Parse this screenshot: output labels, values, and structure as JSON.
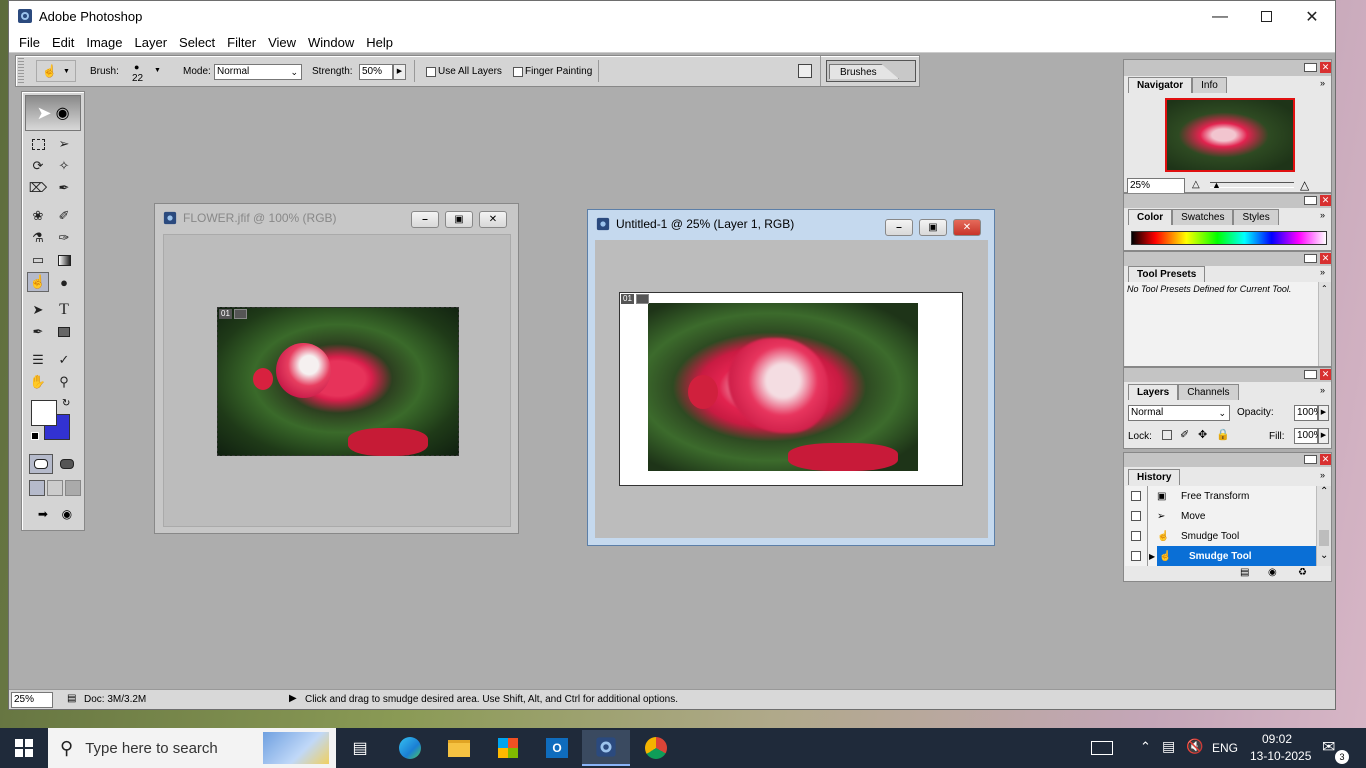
{
  "app": {
    "title": "Adobe Photoshop"
  },
  "menu": [
    "File",
    "Edit",
    "Image",
    "Layer",
    "Select",
    "Filter",
    "View",
    "Window",
    "Help"
  ],
  "options": {
    "brush_label": "Brush:",
    "brush_size": "22",
    "mode_label": "Mode:",
    "mode_value": "Normal",
    "strength_label": "Strength:",
    "strength_value": "50%",
    "use_all_layers": "Use All Layers",
    "finger_painting": "Finger Painting",
    "brushes_tab": "Brushes"
  },
  "doc1": {
    "title": "FLOWER.jfif @ 100% (RGB)",
    "layer_tag": "01"
  },
  "doc2": {
    "title": "Untitled-1 @ 25% (Layer 1, RGB)",
    "layer_tag": "01"
  },
  "navigator": {
    "tabs": [
      "Navigator",
      "Info"
    ],
    "zoom": "25%"
  },
  "color_panel": {
    "tabs": [
      "Color",
      "Swatches",
      "Styles"
    ]
  },
  "tool_presets": {
    "title": "Tool Presets",
    "message": "No Tool Presets Defined for Current Tool."
  },
  "layers": {
    "tabs": [
      "Layers",
      "Channels"
    ],
    "blend_mode": "Normal",
    "opacity_label": "Opacity:",
    "opacity_value": "100%",
    "lock_label": "Lock:",
    "fill_label": "Fill:",
    "fill_value": "100%"
  },
  "history": {
    "title": "History",
    "items": [
      "Free Transform",
      "Move",
      "Smudge Tool",
      "Smudge Tool"
    ],
    "selected_index": 3
  },
  "status": {
    "zoom": "25%",
    "doc": "Doc: 3M/3.2M",
    "hint": "Click and drag to smudge desired area.  Use Shift, Alt, and Ctrl for additional options."
  },
  "taskbar": {
    "search_placeholder": "Type here to search",
    "language": "ENG",
    "time": "09:02",
    "date": "13-10-2025",
    "notifications": "3"
  },
  "colors": {
    "selection": "#0a6fd6",
    "background_swatch": "#3232d2",
    "foreground_swatch": "#ffffff"
  }
}
